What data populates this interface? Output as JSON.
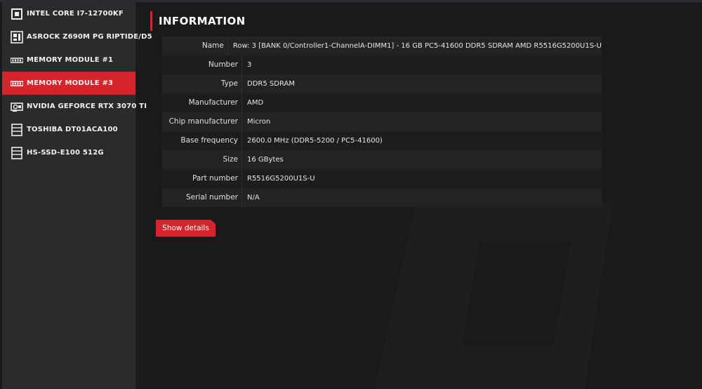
{
  "sidebar": {
    "items": [
      {
        "label": "INTEL CORE I7-12700KF",
        "icon": "cpu-icon"
      },
      {
        "label": "ASROCK Z690M PG RIPTIDE/D5",
        "icon": "motherboard-icon"
      },
      {
        "label": "MEMORY MODULE #1",
        "icon": "memory-icon"
      },
      {
        "label": "MEMORY MODULE #3",
        "icon": "memory-icon",
        "active": true
      },
      {
        "label": "NVIDIA GEFORCE RTX 3070 TI",
        "icon": "gpu-icon"
      },
      {
        "label": "TOSHIBA DT01ACA100",
        "icon": "drive-icon"
      },
      {
        "label": "HS-SSD-E100 512G",
        "icon": "drive-icon"
      }
    ]
  },
  "main": {
    "title": "INFORMATION",
    "rows": [
      {
        "label": "Name",
        "value": "Row: 3 [BANK 0/Controller1-ChannelA-DIMM1] - 16 GB PC5-41600 DDR5 SDRAM AMD R5516G5200U1S-U"
      },
      {
        "label": "Number",
        "value": "3"
      },
      {
        "label": "Type",
        "value": "DDR5 SDRAM"
      },
      {
        "label": "Manufacturer",
        "value": "AMD"
      },
      {
        "label": "Chip manufacturer",
        "value": "Micron"
      },
      {
        "label": "Base frequency",
        "value": "2600.0 MHz (DDR5-5200 / PC5-41600)"
      },
      {
        "label": "Size",
        "value": "16 GBytes"
      },
      {
        "label": "Part number",
        "value": "R5516G5200U1S-U"
      },
      {
        "label": "Serial number",
        "value": "N/A"
      }
    ],
    "show_details_label": "Show details"
  },
  "colors": {
    "accent": "#d4242c",
    "sidebar_bg": "#2b2b2e",
    "main_bg": "#1a1a1c"
  }
}
